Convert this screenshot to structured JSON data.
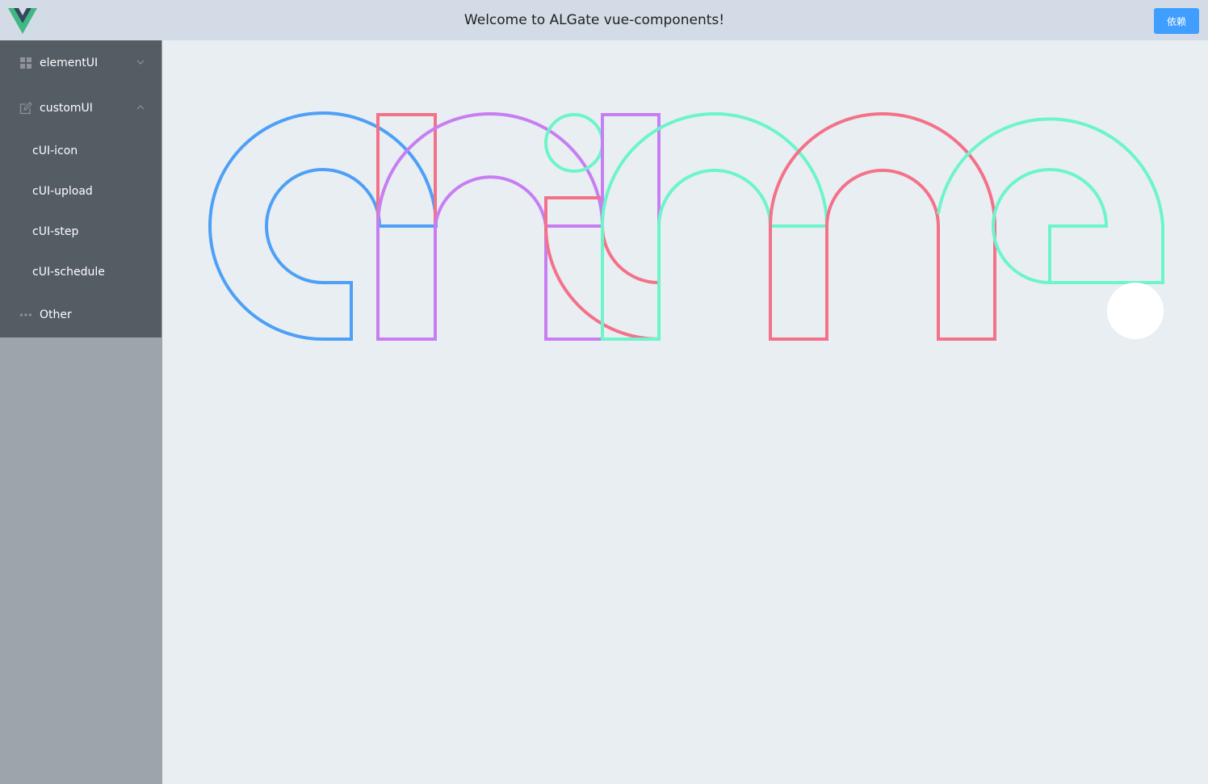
{
  "header": {
    "title": "Welcome to ALGate vue-components!",
    "dependency_button": "依赖",
    "logo_icon": "vue-logo-icon"
  },
  "sidebar": {
    "menus": [
      {
        "label": "elementUI",
        "icon": "grid-icon",
        "expanded": false
      },
      {
        "label": "customUI",
        "icon": "edit-icon",
        "expanded": true,
        "children": [
          "cUI-icon",
          "cUI-upload",
          "cUI-step",
          "cUI-schedule"
        ]
      },
      {
        "label": "Other",
        "icon": "more-icon"
      }
    ]
  },
  "graphic": {
    "description_word": "anime",
    "colors": {
      "blue": "#4da0f5",
      "red": "#f3728a",
      "purple": "#c77ef2",
      "teal": "#6cf5c9"
    }
  }
}
